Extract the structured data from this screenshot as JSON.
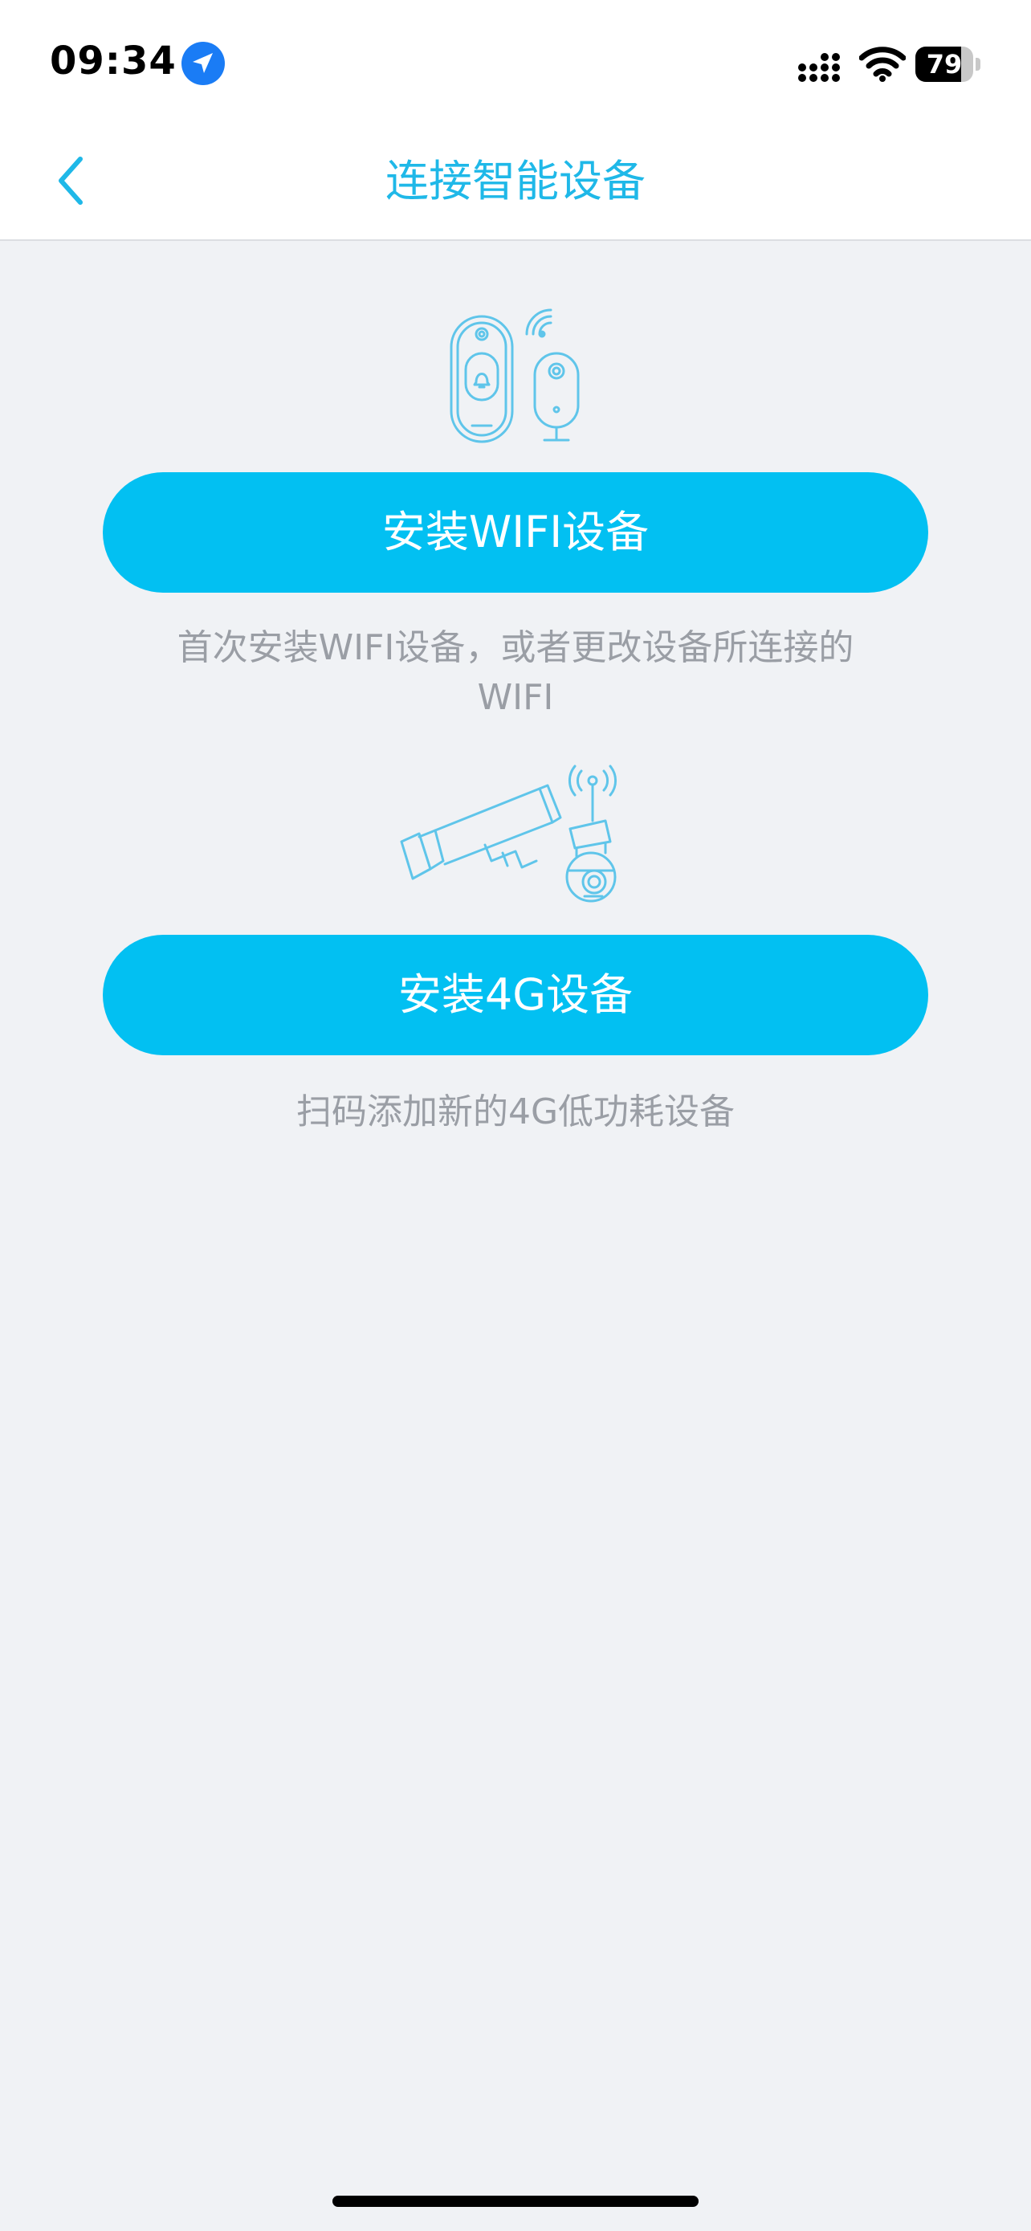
{
  "status_bar": {
    "time": "09:34",
    "battery_level": "79",
    "battery_fraction": 0.79
  },
  "nav": {
    "title": "连接智能设备",
    "back_icon": "chevron-left-icon"
  },
  "options": [
    {
      "button_label": "安装WIFI设备",
      "description": "首次安装WIFI设备，或者更改设备所连接的WIFI",
      "illustration": "wifi-doorbell-camera-illustration"
    },
    {
      "button_label": "安装4G设备",
      "description": "扫码添加新的4G低功耗设备",
      "illustration": "4g-camera-illustration"
    }
  ],
  "colors": {
    "accent": "#02c0f2",
    "title": "#1fb8e8",
    "background": "#f0f2f5",
    "description_text": "#9a9ea5"
  }
}
